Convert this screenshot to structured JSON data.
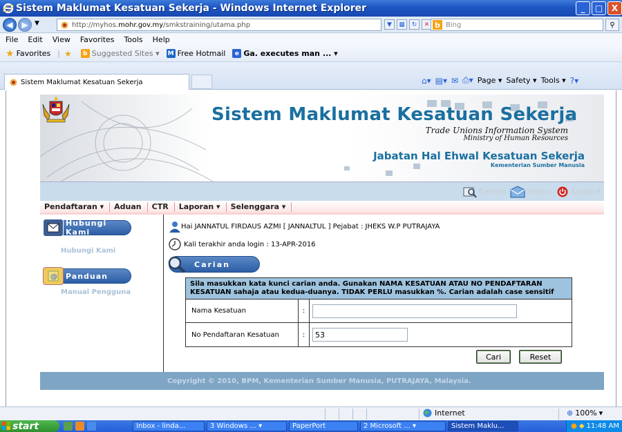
{
  "window": {
    "title": "Sistem Maklumat Kesatuan Sekerja - Windows Internet Explorer",
    "buttons": [
      "_",
      "□",
      "X"
    ]
  },
  "address": {
    "url_prefix": "http://myhos.",
    "url_domain": "mohr.gov.my",
    "url_path": "/smkstraining/utama.php",
    "search_placeholder": "Bing"
  },
  "menubar": [
    "File",
    "Edit",
    "View",
    "Favorites",
    "Tools",
    "Help"
  ],
  "favorites": {
    "label": "Favorites",
    "items": [
      "Suggested Sites ▾",
      "Free Hotmail",
      "Ga. executes man ... ▾"
    ]
  },
  "tab": {
    "title": "Sistem Maklumat Kesatuan Sekerja"
  },
  "commandbar": [
    "Page ▾",
    "Safety ▾",
    "Tools ▾"
  ],
  "banner": {
    "title": "Sistem Maklumat Kesatuan Sekerja",
    "subtitle_en": "Trade Unions Information System",
    "ministry_en": "Ministry of Human Resources",
    "dept": "Jabatan Hal Ehwal Kesatuan Sekerja",
    "ministry_ms": "Kementerian Sumber Manusia"
  },
  "userbar": {
    "carian": "Carian",
    "inbox": "Inbox",
    "logout": "Logout"
  },
  "mainmenu": [
    "Pendaftaran ▾",
    "Aduan",
    "CTR",
    "Laporan ▾",
    "Selenggara ▾"
  ],
  "sidebar": {
    "contact_button": "Hubungi Kami",
    "contact_link": "Hubungi Kami",
    "guide_button": "Panduan",
    "guide_link": "Manual Pengguna"
  },
  "main": {
    "greeting": "Hai JANNATUL FIRDAUS AZMI [ JANNALTUL ] Pejabat : JHEKS W.P PUTRAJAYA",
    "last_login": "Kali terakhir anda login : 13-APR-2016",
    "section_title": "Carian",
    "instruction": "Sila masukkan kata kunci carian anda. Gunakan NAMA KESATUAN ATAU NO PENDAFTARAN KESATUAN sahaja atau kedua-duanya. TIDAK PERLU masukkan %. Carian adalah case sensitif",
    "fields": [
      {
        "label": "Nama Kesatuan",
        "colon": ":",
        "value": ""
      },
      {
        "label": "No Pendaftaran Kesatuan",
        "colon": ":",
        "value": "53"
      }
    ],
    "search_button": "Cari",
    "reset_button": "Reset"
  },
  "footer": "Copyright © 2010, BPM, Kementerian Sumber Manusia, PUTRAJAYA, Malaysia.",
  "statusbar": {
    "zone": "Internet",
    "zoom": "100%"
  },
  "taskbar": {
    "start": "start",
    "buttons": [
      "Inbox - linda...",
      "3 Windows ... ▾",
      "PaperPort",
      "2 Microsoft ... ▾",
      "Sistem Maklu..."
    ],
    "clock": "11:48 AM"
  }
}
